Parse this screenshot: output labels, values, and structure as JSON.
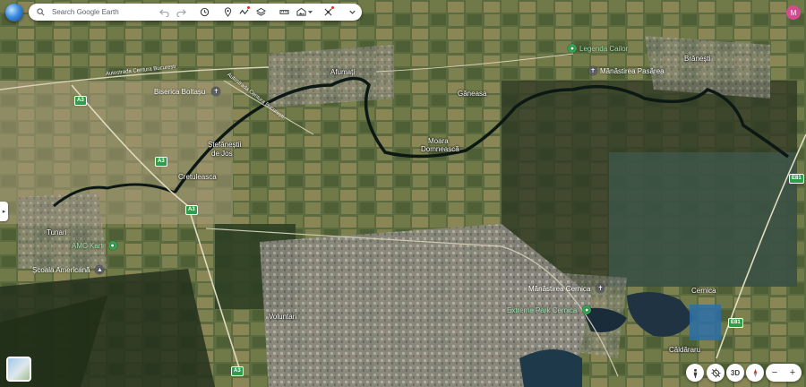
{
  "search": {
    "placeholder": "Search Google Earth"
  },
  "avatar": {
    "initial": "M",
    "color": "#d24c8f"
  },
  "side_toggle": {
    "glyph": "▸"
  },
  "controls": {
    "label_3d": "3D",
    "zoom_out": "−",
    "zoom_in": "+"
  },
  "places": {
    "afumati": "Afumați",
    "ganeasa": "Găneasa",
    "branesti": "Brănești",
    "moara_1": "Moara",
    "moara_2": "Domnească",
    "stefanesti_1": "Ștefăneștii",
    "stefanesti_2": "de Jos",
    "cretuleasca": "Cretuleasca",
    "tunari": "Tunari",
    "voluntari": "Voluntari",
    "cernica": "Cernica",
    "caldararu": "Căldăraru"
  },
  "pois": {
    "legenda": "Legenda Cailor",
    "manastirea_pasarea": "Mănăstirea Pasărea",
    "biserica": "Biserica Boltașu",
    "amc_kart": "AMC Kart",
    "scoala": "Școala Americană",
    "manastirea_cernica": "Mănăstirea Cernica",
    "extreme_park": "Extreme Park Cernica"
  },
  "roads": {
    "a3": "A3",
    "e81": "E81",
    "centura": "Autostrada Centura București"
  },
  "colors": {
    "poi_green": "#34a853",
    "poi_gray": "#5f6368",
    "road_green": "#2e9e48"
  }
}
